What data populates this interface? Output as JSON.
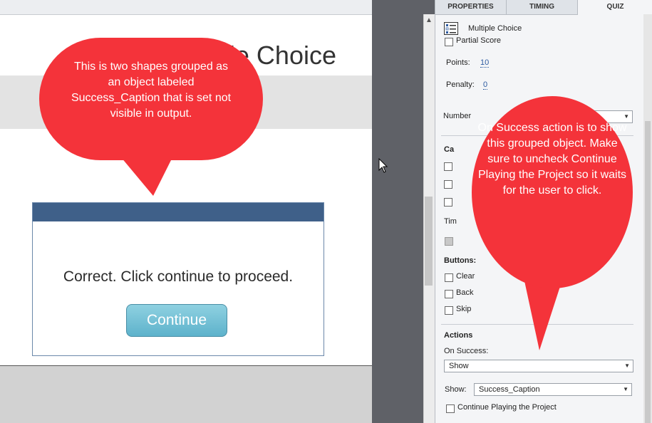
{
  "slide": {
    "title": "le Choice",
    "success_caption": {
      "message": "Correct. Click continue to proceed.",
      "button_label": "Continue"
    }
  },
  "panel": {
    "tabs": [
      {
        "label": "PROPERTIES"
      },
      {
        "label": "TIMING"
      },
      {
        "label": "QUIZ",
        "active": true
      }
    ],
    "object_type": "Multiple Choice",
    "partial_score_label": "Partial Score",
    "points_label": "Points:",
    "points_value": "10",
    "penalty_label": "Penalty:",
    "penalty_value": "0",
    "numbering_label": "Number",
    "captions_label": "Ca",
    "timer_label": "Tim",
    "buttons_label": "Buttons:",
    "buttons": [
      {
        "label": "Clear"
      },
      {
        "label": "Back"
      },
      {
        "label": "Skip"
      }
    ],
    "actions_label": "Actions",
    "on_success_label": "On Success:",
    "on_success_value": "Show",
    "show_label": "Show:",
    "show_value": "Success_Caption",
    "continue_label": "Continue Playing the Project"
  },
  "callouts": {
    "left": "This is two shapes grouped as an object labeled Success_Caption that is set not visible in output.",
    "right": "On Success action is to show this grouped object. Make sure to uncheck Continue Playing the Project so it waits for the user to click."
  },
  "colors": {
    "callout": "#f4333a",
    "caption_header": "#3f6089",
    "continue_button": "#6cbad0"
  }
}
